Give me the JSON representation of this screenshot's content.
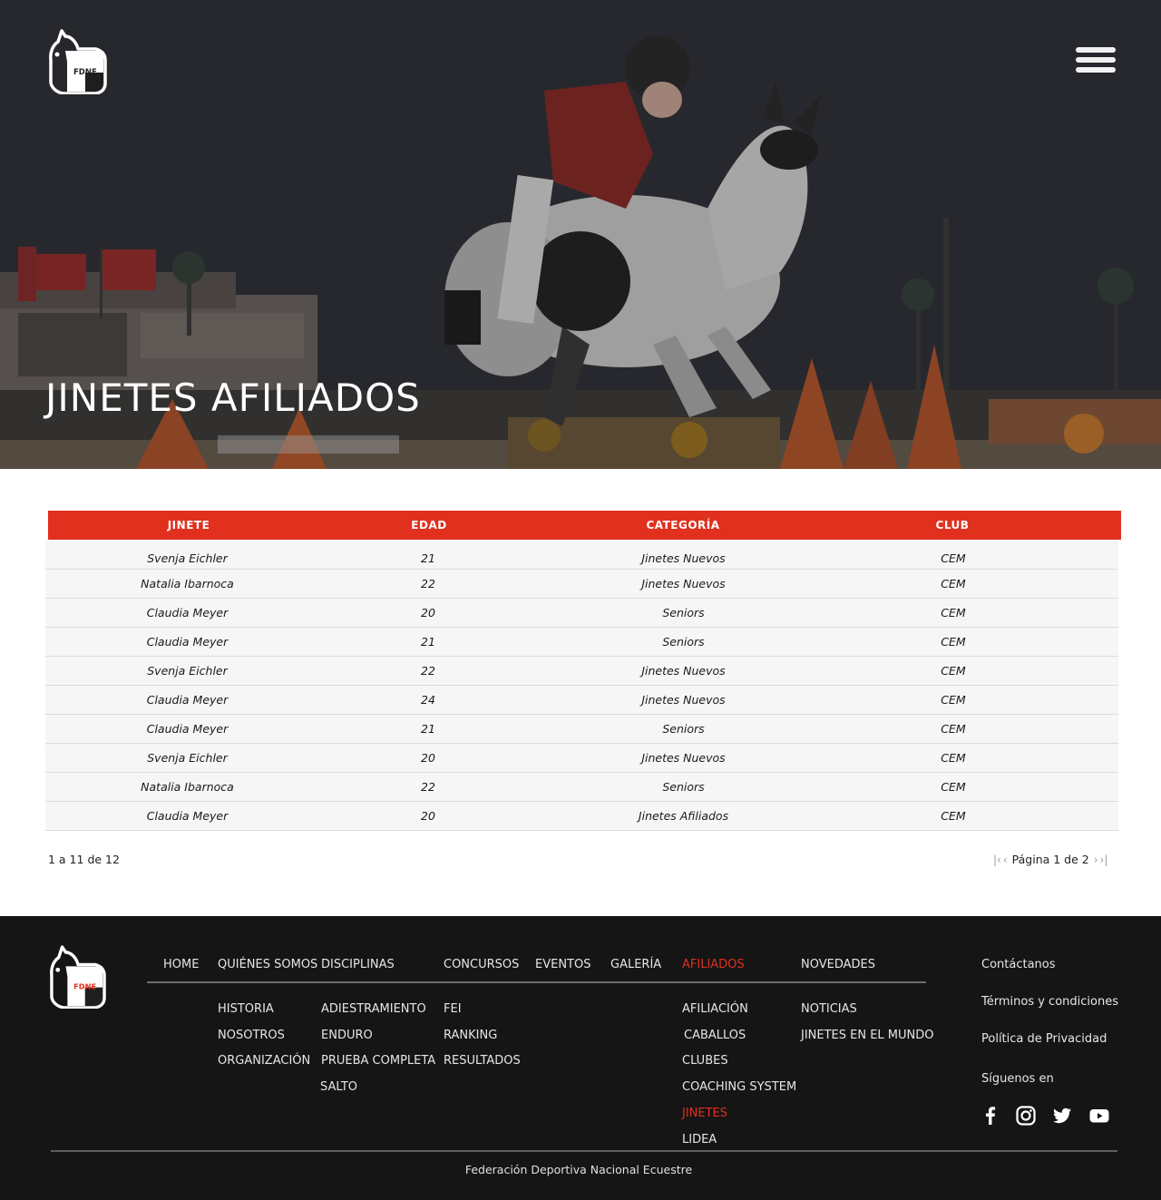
{
  "header": {
    "logo_text": "FDNE",
    "title": "JINETES AFILIADOS",
    "menu_icon": "hamburger-menu-icon"
  },
  "table": {
    "columns": [
      "JINETE",
      "EDAD",
      "CATEGORÍA",
      "CLUB"
    ],
    "rows": [
      [
        "Svenja Eichler",
        "21",
        "Jinetes Nuevos",
        "CEM"
      ],
      [
        "Natalia Ibarnoca",
        "22",
        "Jinetes Nuevos",
        "CEM"
      ],
      [
        "Claudia Meyer",
        "20",
        "Seniors",
        "CEM"
      ],
      [
        "Claudia Meyer",
        "21",
        "Seniors",
        "CEM"
      ],
      [
        "Svenja Eichler",
        "22",
        "Jinetes Nuevos",
        "CEM"
      ],
      [
        "Claudia Meyer",
        "24",
        "Jinetes Nuevos",
        "CEM"
      ],
      [
        "Claudia Meyer",
        "21",
        "Seniors",
        "CEM"
      ],
      [
        "Svenja Eichler",
        "20",
        "Jinetes Nuevos",
        "CEM"
      ],
      [
        "Natalia Ibarnoca",
        "22",
        "Seniors",
        "CEM"
      ],
      [
        "Claudia Meyer",
        "20",
        "Jinetes Afiliados",
        "CEM"
      ]
    ],
    "count_text": "1 a 11 de 12",
    "pager": {
      "first": "|‹",
      "prev": "‹",
      "page_text": "Página 1 de 2",
      "next": "›",
      "last": "›|"
    }
  },
  "footer": {
    "logo_text": "FDNE",
    "nav": {
      "home": "HOME",
      "quienes": "QUIÉNES SOMOS",
      "disciplinas": "DISCIPLINAS",
      "concursos": "CONCURSOS",
      "eventos": "EVENTOS",
      "galeria": "GALERÍA",
      "afiliados": "AFILIADOS",
      "novedades": "NOVEDADES"
    },
    "quienes_sub": [
      "HISTORIA",
      "NOSOTROS",
      "ORGANIZACIÓN"
    ],
    "disciplinas_sub": [
      "ADIESTRAMIENTO",
      "ENDURO",
      "PRUEBA COMPLETA",
      "SALTO"
    ],
    "concursos_sub": [
      "FEI",
      "RANKING",
      "RESULTADOS"
    ],
    "afiliados_sub": [
      "AFILIACIÓN",
      "CABALLOS",
      "CLUBES",
      "COACHING SYSTEM",
      "JINETES",
      "LIDEA"
    ],
    "novedades_sub": [
      "NOTICIAS",
      "JINETES EN EL MUNDO"
    ],
    "contact": "Contáctanos",
    "terms": "Términos y condiciones",
    "privacy": "Política de Privacidad",
    "follow": "Síguenos en",
    "social_icons": [
      "facebook-icon",
      "instagram-icon",
      "twitter-icon",
      "youtube-icon"
    ],
    "copyright": "Federación Deportiva Nacional Ecuestre",
    "accent": "#e1301e"
  }
}
